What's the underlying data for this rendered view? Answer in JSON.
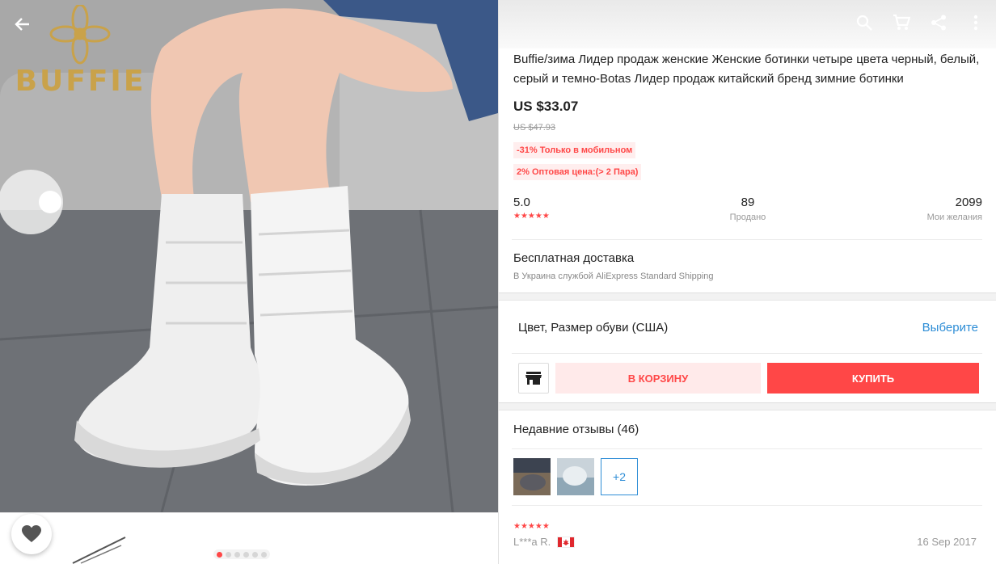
{
  "brand": {
    "name": "BUFFIE"
  },
  "gallery": {
    "page_count": 6,
    "active_page": 1
  },
  "toolbar": {
    "back_icon": "arrow-left-icon",
    "icons": [
      "search-icon",
      "cart-icon",
      "share-icon",
      "more-vert-icon"
    ]
  },
  "product": {
    "title": "Buffie/зима Лидер продаж женские Женские ботинки четыре цвета черный, белый, серый и темно-Botas Лидер продаж китайский бренд зимние ботинки",
    "price": "US $33.07",
    "old_price": "US $47.93",
    "promo_mobile": "-31% Только в мобильном",
    "promo_wholesale": "2% Оптовая цена:(> 2 Пара)"
  },
  "stats": {
    "rating": "5.0",
    "rating_stars": 5,
    "sold_value": "89",
    "sold_label": "Продано",
    "wishlist_value": "2099",
    "wishlist_label": "Мои желания"
  },
  "shipping": {
    "title": "Бесплатная доставка",
    "subtitle": "В Украина службой AliExpress Standard Shipping"
  },
  "variant": {
    "label": "Цвет, Размер обуви (США)",
    "action": "Выберите"
  },
  "actions": {
    "cart_label": "В КОРЗИНУ",
    "buy_label": "КУПИТЬ"
  },
  "reviews": {
    "title": "Недавние отзывы (46)",
    "more_label": "+2",
    "first": {
      "stars": 5,
      "author": "L***a R.",
      "country_flag": "canada-flag-icon",
      "date": "16 Sep 2017"
    }
  },
  "colors": {
    "accent": "#ff4747",
    "link": "#2d8dd6",
    "promo_bg": "#ffeeee",
    "brand_gold": "#c9a24a"
  }
}
